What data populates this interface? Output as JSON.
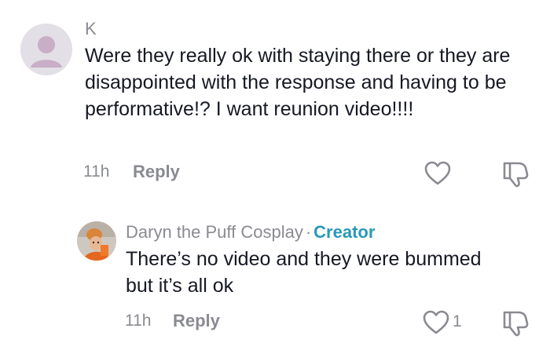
{
  "comment": {
    "username": "K",
    "text": "Were they really ok with staying there or they are disappointed with the response and having to be performative!? I want reunion video!!!!",
    "time": "11h",
    "reply_label": "Reply",
    "avatar_icon": "default-user-avatar-icon",
    "like_icon": "heart-outline-icon",
    "dislike_icon": "thumbs-down-icon"
  },
  "reply": {
    "username": "Daryn the Puff Cosplay",
    "separator": "·",
    "creator_label": "Creator",
    "text": "There’s no video and they were bummed but it’s all ok",
    "time": "11h",
    "reply_label": "Reply",
    "like_count": "1",
    "avatar_icon": "creator-avatar-photo",
    "like_icon": "heart-outline-icon",
    "dislike_icon": "thumbs-down-icon"
  },
  "colors": {
    "text": "#161823",
    "muted": "#8a8b91",
    "creator_accent": "#2a98b8",
    "avatar_bg": "#e3dfe6"
  }
}
